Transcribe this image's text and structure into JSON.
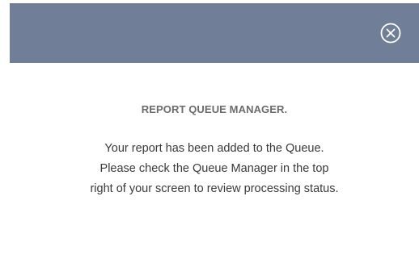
{
  "modal": {
    "header_color": "#717e97",
    "close_icon": "close-circle-icon",
    "title": "REPORT QUEUE MANAGER.",
    "message_lines": [
      "Your report has been added to the Queue.",
      "Please check the Queue Manager in the top",
      "right of your screen to review processing status."
    ]
  }
}
